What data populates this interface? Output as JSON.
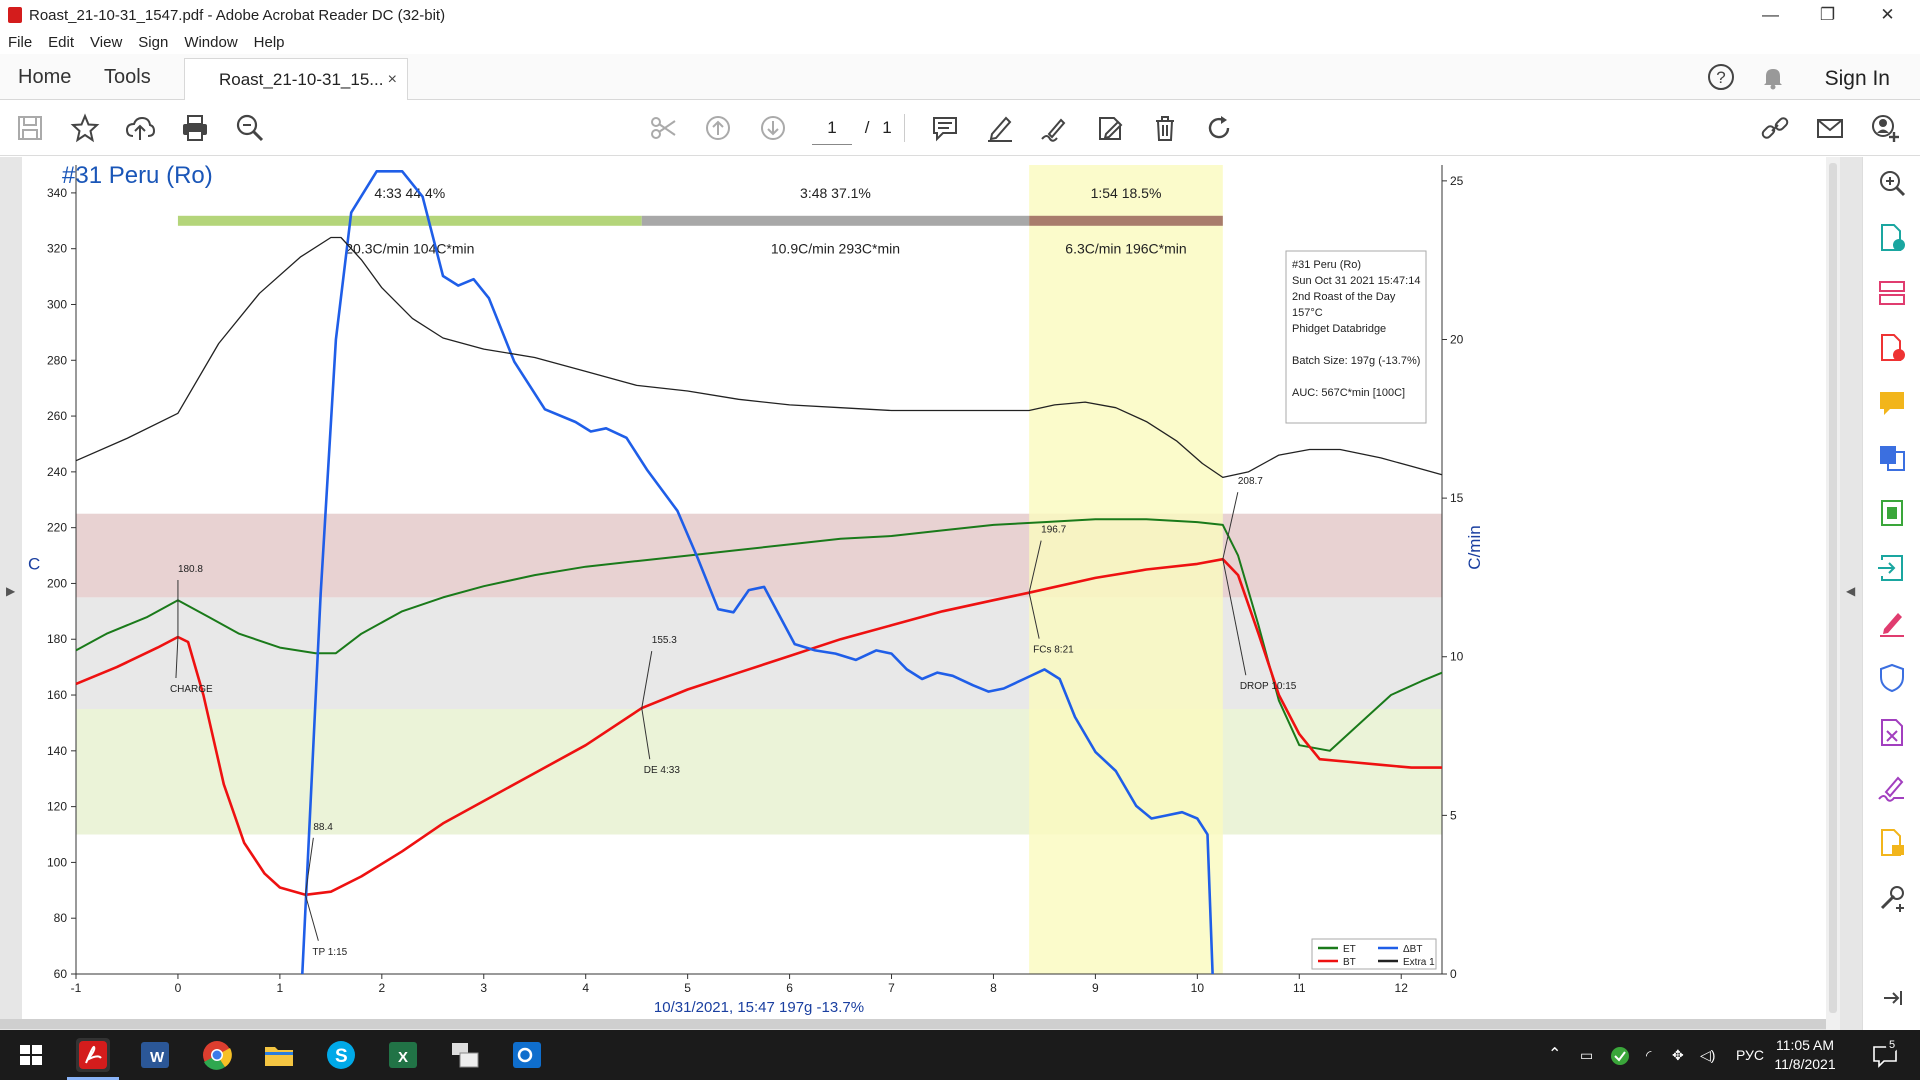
{
  "window": {
    "title": "Roast_21-10-31_1547.pdf - Adobe Acrobat Reader DC (32-bit)",
    "controls": [
      "—",
      "❐",
      "✕"
    ]
  },
  "menu": [
    "File",
    "Edit",
    "View",
    "Sign",
    "Window",
    "Help"
  ],
  "tabs": {
    "home": "Home",
    "tools": "Tools",
    "document": "Roast_21-10-31_15...",
    "close": "×",
    "sign_in": "Sign In"
  },
  "toolbar": {
    "page_current": "1",
    "page_separator": "/",
    "page_total": "1"
  },
  "colors": {
    "et": "#1a7a1a",
    "bt": "#ee1111",
    "delta_bt": "#1f5ee8",
    "extra1": "#222222",
    "title": "#1a56b8",
    "phase_dry": "#b4d57a",
    "phase_maillard": "#a8a8a8",
    "phase_finish": "#a87c6c",
    "band_red": "#e8d2d2",
    "band_grey": "#e8e8e8",
    "band_green": "#ebf3d8",
    "highlight": "#fafac0"
  },
  "chart_data": {
    "type": "line",
    "title": "#31 Peru (Ro)",
    "xlabel": "10/31/2021, 15:47   197g  -13.7%",
    "ylabel": "C",
    "y2label": "C/min",
    "xlim": [
      -1,
      12.4
    ],
    "ylim": [
      60,
      350
    ],
    "y2lim": [
      0,
      25.5
    ],
    "x_ticks": [
      -1,
      0,
      1,
      2,
      3,
      4,
      5,
      6,
      7,
      8,
      9,
      10,
      11,
      12
    ],
    "y_ticks": [
      60,
      80,
      100,
      120,
      140,
      160,
      180,
      200,
      220,
      240,
      260,
      280,
      300,
      320,
      340
    ],
    "y2_ticks": [
      0,
      5,
      10,
      15,
      20,
      25
    ],
    "grid": false,
    "legend_position": "bottom-right",
    "bands": [
      {
        "from": 195,
        "to": 225,
        "color": "#e8d2d2"
      },
      {
        "from": 155,
        "to": 195,
        "color": "#e8e8e8"
      },
      {
        "from": 110,
        "to": 155,
        "color": "#ebf3d8"
      }
    ],
    "highlight_x": [
      8.35,
      10.25
    ],
    "phases": [
      {
        "from": 0,
        "to": 4.55,
        "label": "4:33  44.4%",
        "stats": "20.3C/min  104C*min",
        "color": "#b4d57a"
      },
      {
        "from": 4.55,
        "to": 8.35,
        "label": "3:48  37.1%",
        "stats": "10.9C/min  293C*min",
        "color": "#a8a8a8"
      },
      {
        "from": 8.35,
        "to": 10.25,
        "label": "1:54  18.5%",
        "stats": "6.3C/min  196C*min",
        "color": "#a87c6c"
      }
    ],
    "series": [
      {
        "name": "ET",
        "axis": "left",
        "color": "#1a7a1a",
        "points": [
          [
            -1,
            176
          ],
          [
            -0.7,
            182
          ],
          [
            -0.3,
            188
          ],
          [
            0,
            194
          ],
          [
            0.3,
            188
          ],
          [
            0.6,
            182
          ],
          [
            1,
            177
          ],
          [
            1.35,
            175
          ],
          [
            1.55,
            175
          ],
          [
            1.8,
            182
          ],
          [
            2.2,
            190
          ],
          [
            2.6,
            195
          ],
          [
            3,
            199
          ],
          [
            3.5,
            203
          ],
          [
            4,
            206
          ],
          [
            4.5,
            208
          ],
          [
            5,
            210
          ],
          [
            5.5,
            212
          ],
          [
            6,
            214
          ],
          [
            6.5,
            216
          ],
          [
            7,
            217
          ],
          [
            7.5,
            219
          ],
          [
            8,
            221
          ],
          [
            8.5,
            222
          ],
          [
            9,
            223
          ],
          [
            9.5,
            223
          ],
          [
            10,
            222
          ],
          [
            10.25,
            221
          ],
          [
            10.4,
            210
          ],
          [
            10.6,
            185
          ],
          [
            10.8,
            158
          ],
          [
            11,
            142
          ],
          [
            11.3,
            140
          ],
          [
            11.6,
            150
          ],
          [
            11.9,
            160
          ],
          [
            12.2,
            165
          ],
          [
            12.4,
            168
          ]
        ]
      },
      {
        "name": "BT",
        "axis": "left",
        "color": "#ee1111",
        "points": [
          [
            -1,
            164
          ],
          [
            -0.6,
            170
          ],
          [
            -0.2,
            177
          ],
          [
            0,
            180.8
          ],
          [
            0.1,
            179
          ],
          [
            0.25,
            160
          ],
          [
            0.45,
            128
          ],
          [
            0.65,
            107
          ],
          [
            0.85,
            96
          ],
          [
            1,
            91
          ],
          [
            1.25,
            88.4
          ],
          [
            1.5,
            89.5
          ],
          [
            1.8,
            95
          ],
          [
            2.2,
            104
          ],
          [
            2.6,
            114
          ],
          [
            3,
            122
          ],
          [
            3.5,
            132
          ],
          [
            4,
            142
          ],
          [
            4.55,
            155.3
          ],
          [
            5,
            162
          ],
          [
            5.5,
            168
          ],
          [
            6,
            174
          ],
          [
            6.5,
            180
          ],
          [
            7,
            185
          ],
          [
            7.5,
            190
          ],
          [
            8,
            194
          ],
          [
            8.35,
            196.7
          ],
          [
            9,
            202
          ],
          [
            9.5,
            205
          ],
          [
            10,
            207
          ],
          [
            10.25,
            208.7
          ],
          [
            10.4,
            203
          ],
          [
            10.6,
            182
          ],
          [
            10.8,
            160
          ],
          [
            11,
            146
          ],
          [
            11.2,
            137
          ],
          [
            11.5,
            136
          ],
          [
            11.8,
            135
          ],
          [
            12.1,
            134
          ],
          [
            12.4,
            134
          ]
        ]
      },
      {
        "name": "ΔBT",
        "axis": "right",
        "color": "#1f5ee8",
        "points": [
          [
            1.22,
            0
          ],
          [
            1.4,
            12
          ],
          [
            1.55,
            20
          ],
          [
            1.7,
            24
          ],
          [
            1.95,
            25.3
          ],
          [
            2.2,
            25.3
          ],
          [
            2.4,
            24.5
          ],
          [
            2.6,
            22
          ],
          [
            2.75,
            21.7
          ],
          [
            2.9,
            21.9
          ],
          [
            3.05,
            21.3
          ],
          [
            3.3,
            19.3
          ],
          [
            3.6,
            17.8
          ],
          [
            3.9,
            17.4
          ],
          [
            4.05,
            17.1
          ],
          [
            4.2,
            17.2
          ],
          [
            4.4,
            16.9
          ],
          [
            4.6,
            15.9
          ],
          [
            4.9,
            14.6
          ],
          [
            5.1,
            13.1
          ],
          [
            5.3,
            11.5
          ],
          [
            5.45,
            11.4
          ],
          [
            5.6,
            12.1
          ],
          [
            5.75,
            12.2
          ],
          [
            5.9,
            11.3
          ],
          [
            6.05,
            10.4
          ],
          [
            6.25,
            10.2
          ],
          [
            6.45,
            10.1
          ],
          [
            6.65,
            9.9
          ],
          [
            6.85,
            10.2
          ],
          [
            7,
            10.1
          ],
          [
            7.15,
            9.6
          ],
          [
            7.3,
            9.3
          ],
          [
            7.45,
            9.5
          ],
          [
            7.6,
            9.4
          ],
          [
            7.8,
            9.1
          ],
          [
            7.95,
            8.9
          ],
          [
            8.1,
            9.0
          ],
          [
            8.3,
            9.3
          ],
          [
            8.5,
            9.6
          ],
          [
            8.65,
            9.3
          ],
          [
            8.8,
            8.1
          ],
          [
            9.0,
            7.0
          ],
          [
            9.2,
            6.4
          ],
          [
            9.4,
            5.3
          ],
          [
            9.55,
            4.9
          ],
          [
            9.7,
            5.0
          ],
          [
            9.85,
            5.1
          ],
          [
            10.0,
            4.9
          ],
          [
            10.1,
            4.4
          ],
          [
            10.15,
            0
          ]
        ]
      },
      {
        "name": "Extra 1",
        "axis": "left",
        "color": "#222222",
        "points": [
          [
            -1,
            244
          ],
          [
            -0.5,
            252
          ],
          [
            0,
            261
          ],
          [
            0.4,
            286
          ],
          [
            0.8,
            304
          ],
          [
            1.2,
            317
          ],
          [
            1.5,
            324
          ],
          [
            1.6,
            324
          ],
          [
            1.8,
            316
          ],
          [
            2,
            306
          ],
          [
            2.3,
            295
          ],
          [
            2.6,
            288
          ],
          [
            3,
            284
          ],
          [
            3.5,
            281
          ],
          [
            4,
            276
          ],
          [
            4.5,
            271
          ],
          [
            5,
            269
          ],
          [
            5.5,
            266
          ],
          [
            6,
            264
          ],
          [
            6.5,
            263
          ],
          [
            7,
            262
          ],
          [
            7.5,
            262
          ],
          [
            8,
            262
          ],
          [
            8.35,
            262
          ],
          [
            8.6,
            264
          ],
          [
            8.9,
            265
          ],
          [
            9.2,
            263
          ],
          [
            9.5,
            258
          ],
          [
            9.8,
            251
          ],
          [
            10.05,
            243
          ],
          [
            10.25,
            238
          ],
          [
            10.5,
            240
          ],
          [
            10.8,
            246
          ],
          [
            11.1,
            248
          ],
          [
            11.4,
            248
          ],
          [
            11.8,
            245
          ],
          [
            12.1,
            242
          ],
          [
            12.4,
            239
          ]
        ]
      }
    ],
    "annotations": [
      {
        "x": 0,
        "y": 180.8,
        "value": "180.8",
        "event": "CHARGE"
      },
      {
        "x": 1.25,
        "y": 88.4,
        "value": "88.4",
        "event": "TP 1:15"
      },
      {
        "x": 4.55,
        "y": 155.3,
        "value": "155.3",
        "event": "DE 4:33"
      },
      {
        "x": 8.35,
        "y": 196.7,
        "value": "196.7",
        "event": "FCs 8:21"
      },
      {
        "x": 10.25,
        "y": 208.7,
        "value": "208.7",
        "event": "DROP 10:15"
      }
    ],
    "info_box": [
      "#31 Peru (Ro)",
      "Sun Oct 31 2021 15:47:14",
      "2nd Roast of the Day",
      "157°C",
      "Phidget Databridge",
      "",
      "Batch Size: 197g (-13.7%)",
      "",
      "AUC: 567C*min [100C]"
    ]
  },
  "taskbar": {
    "tray_lang": "РУС",
    "clock_time": "11:05 AM",
    "clock_date": "11/8/2021",
    "notification_count": "5"
  }
}
